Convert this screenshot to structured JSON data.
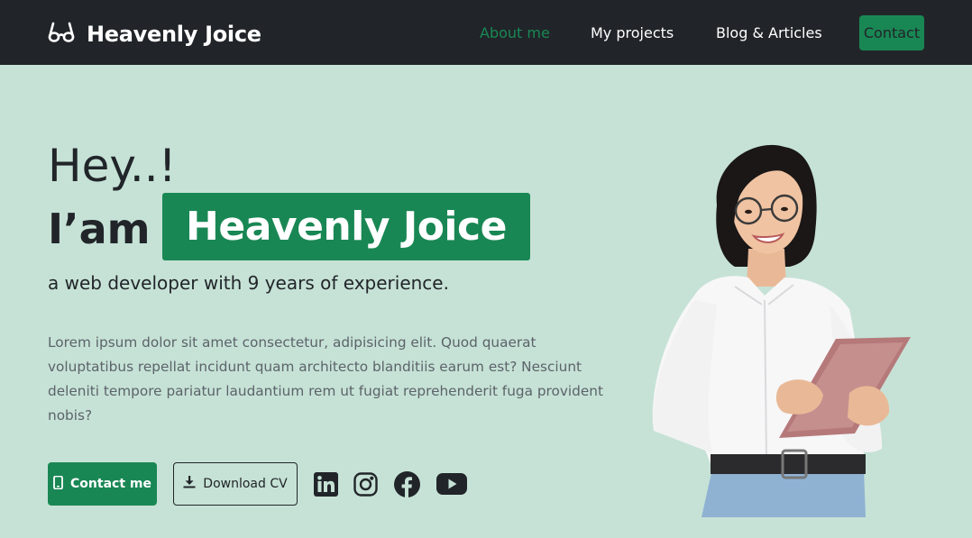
{
  "navbar": {
    "brand_name": "Heavenly Joice",
    "brand_icon": "glasses-icon",
    "links": [
      {
        "label": "About me",
        "active": true
      },
      {
        "label": "My projects",
        "active": false
      },
      {
        "label": "Blog & Articles",
        "active": false
      }
    ],
    "contact_label": "Contact"
  },
  "hero": {
    "greeting": "Hey..!",
    "intro": "I’am",
    "name": "Heavenly Joice",
    "tagline": "a web developer with 9 years of experience.",
    "bio": "Lorem ipsum dolor sit amet consectetur, adipisicing elit. Quod quaerat voluptatibus repellat incidunt quam architecto blanditiis earum est? Nesciunt deleniti tempore pariatur laudantium rem ut fugiat reprehenderit fuga provident nobis?",
    "contact_button": "Contact me",
    "download_button": "Download CV"
  },
  "social": [
    "linkedin-icon",
    "instagram-icon",
    "facebook-icon",
    "youtube-icon"
  ],
  "colors": {
    "accent": "#198754",
    "navbar_bg": "#212529",
    "hero_bg": "#c6e2d6",
    "text_dark": "#212529",
    "text_muted": "#5c636a"
  }
}
